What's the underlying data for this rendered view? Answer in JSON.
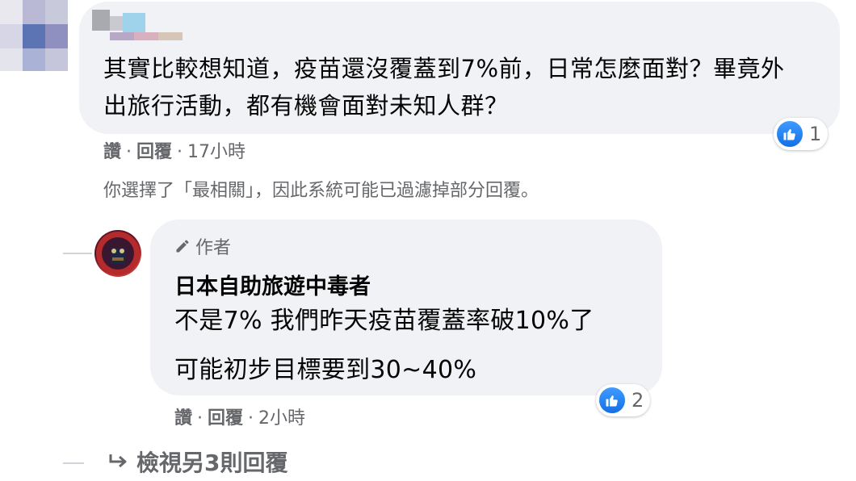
{
  "comment": {
    "text": "其實比較想知道，疫苗還沒覆蓋到7%前，日常怎麼面對？畢竟外出旅行活動，都有機會面對未知人群？",
    "actions": {
      "like": "讚",
      "reply": "回覆",
      "time": "17小時"
    },
    "reaction_count": "1",
    "filter_note": "你選擇了「最相關」，因此系統可能已過濾掉部分回覆。"
  },
  "reply": {
    "author_badge": "作者",
    "author_name": "日本自助旅遊中毒者",
    "line1": "不是7% 我們昨天疫苗覆蓋率破10%了",
    "line2": "可能初步目標要到30~40%",
    "actions": {
      "like": "讚",
      "reply": "回覆",
      "time": "2小時"
    },
    "reaction_count": "2"
  },
  "view_more": {
    "label": "檢視另3則回覆"
  },
  "icons": {
    "reaction": "like-icon",
    "badge": "pencil-icon",
    "view_more": "reply-arrow-icon"
  },
  "colors": {
    "bubble": "#f0f2f5",
    "secondary_text": "#65676b",
    "like_blue": "#1877f2"
  }
}
